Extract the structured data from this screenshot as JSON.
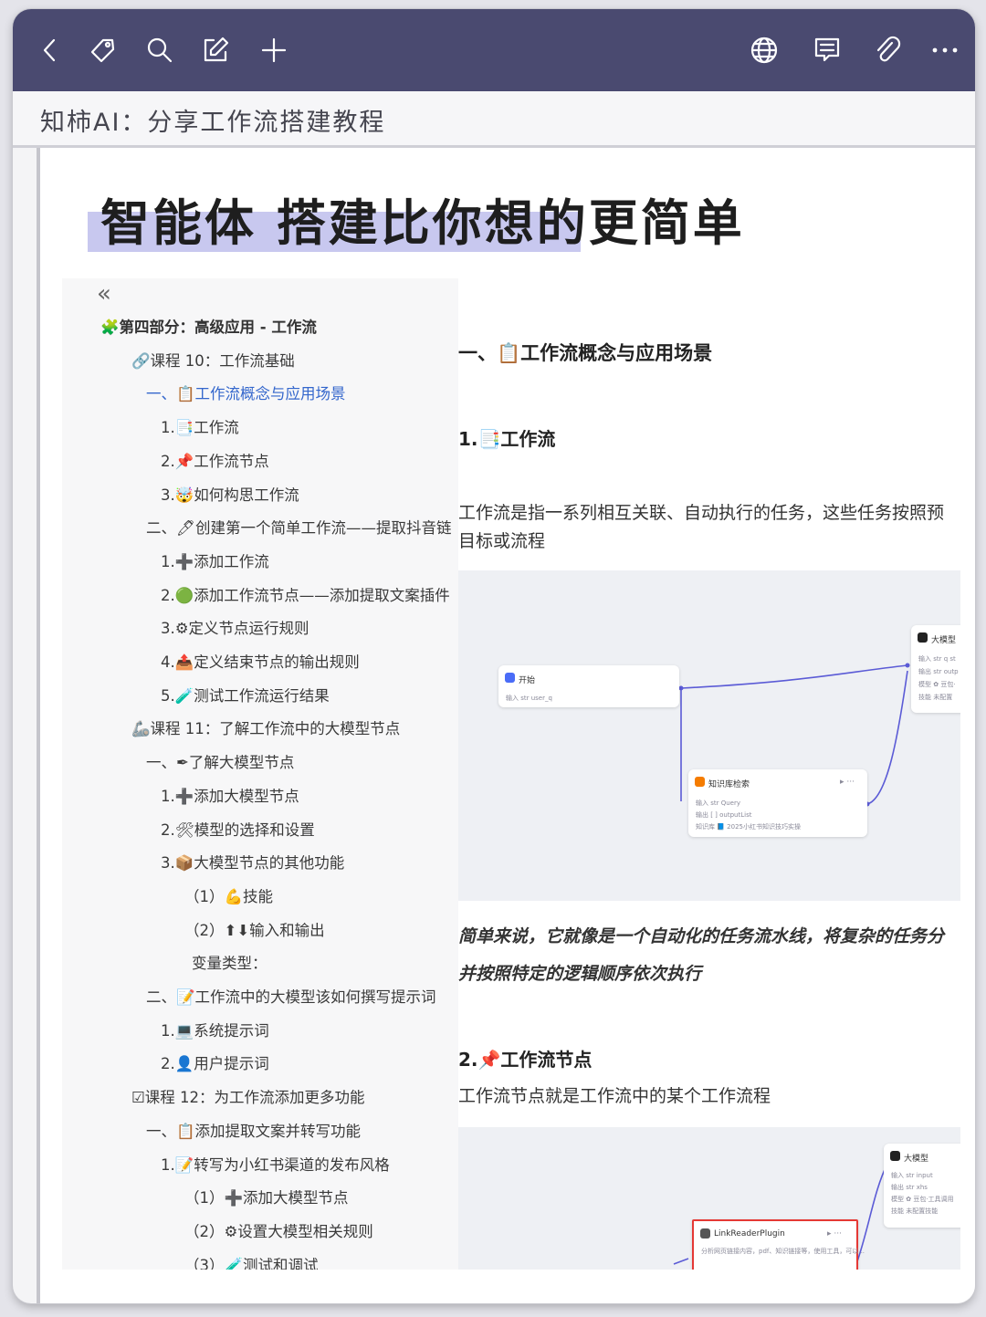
{
  "toolbar": {
    "icons": [
      "back-icon",
      "tag-icon",
      "search-icon",
      "edit-icon",
      "add-icon",
      "globe-icon",
      "comment-icon",
      "attachment-icon",
      "more-icon"
    ]
  },
  "note": {
    "title": "知柿AI：分享工作流搭建教程"
  },
  "headline": "智能体 搭建比你想的更简单",
  "toc": {
    "collapse": "«",
    "items": [
      {
        "label": "🧩第四部分：高级应用 - 工作流"
      },
      {
        "label": "🔗课程 10：工作流基础"
      },
      {
        "label": "一、📋工作流概念与应用场景"
      },
      {
        "label": "1.📑工作流"
      },
      {
        "label": "2.📌工作流节点"
      },
      {
        "label": "3.🤯如何构思工作流"
      },
      {
        "label": "二、🖊创建第一个简单工作流——提取抖音链"
      },
      {
        "label": "1.➕添加工作流"
      },
      {
        "label": "2.🟢添加工作流节点——添加提取文案插件"
      },
      {
        "label": "3.⚙定义节点运行规则"
      },
      {
        "label": "4.📤定义结束节点的输出规则"
      },
      {
        "label": "5.🧪测试工作流运行结果"
      },
      {
        "label": "🦾课程 11：了解工作流中的大模型节点"
      },
      {
        "label": "一、✒了解大模型节点"
      },
      {
        "label": "1.➕添加大模型节点"
      },
      {
        "label": "2.🛠模型的选择和设置"
      },
      {
        "label": "3.📦大模型节点的其他功能"
      },
      {
        "label": "（1）💪技能"
      },
      {
        "label": "（2）⬆⬇输入和输出"
      },
      {
        "label": "变量类型："
      },
      {
        "label": "二、📝工作流中的大模型该如何撰写提示词"
      },
      {
        "label": "1.💻系统提示词"
      },
      {
        "label": "2.👤用户提示词"
      },
      {
        "label": "☑课程 12：为工作流添加更多功能"
      },
      {
        "label": "一、📋添加提取文案并转写功能"
      },
      {
        "label": "1.📝转写为小红书渠道的发布风格"
      },
      {
        "label": "（1）➕添加大模型节点"
      },
      {
        "label": "（2）⚙设置大模型相关规则"
      },
      {
        "label": "（3）🧪测试和调试"
      }
    ]
  },
  "content": {
    "h1": "一、📋工作流概念与应用场景",
    "h2_workflow": "1.📑工作流",
    "para1_line1": "工作流是指一系列相互关联、自动执行的任务，这些任务按照预",
    "para1_line2": "目标或流程",
    "quote_line1": "简单来说，它就像是一个自动化的任务流水线，将复杂的任务分",
    "quote_line2": "并按照特定的逻辑顺序依次执行",
    "h2_node": "2.📌工作流节点",
    "para2": "工作流节点就是工作流中的某个工作流程"
  },
  "flow1": {
    "start": {
      "title": "开始",
      "row": "输入  str user_q"
    },
    "knowledge": {
      "title": "知识库检索",
      "controls": "▸ ···",
      "rows": [
        "输入  str Query",
        "输出  [ ] outputList",
        "知识库  📘 2025小红书知识技巧实操"
      ]
    },
    "llm": {
      "title": "大模型",
      "rows": [
        "输入  str q  st",
        "输出  str outp",
        "模型  ✿ 豆包·",
        "技能  未配置"
      ]
    }
  },
  "flow2": {
    "plugin": {
      "title": "LinkReaderPlugin",
      "controls": "▸ ···",
      "row": "分析网页链接内容，pdf、知识链接等，使用工具，可以..."
    },
    "llm": {
      "title": "大模型",
      "rows": [
        "输入  str input",
        "输出  str xhs",
        "模型  ✿ 豆包·工具调用",
        "技能  未配置技能"
      ]
    }
  },
  "colors": {
    "toolbar": "#4a4a70",
    "highlight": "#c8c8ef",
    "active_link": "#3366cc",
    "connector": "#5b5bd6",
    "plugin_border": "#e53935"
  }
}
